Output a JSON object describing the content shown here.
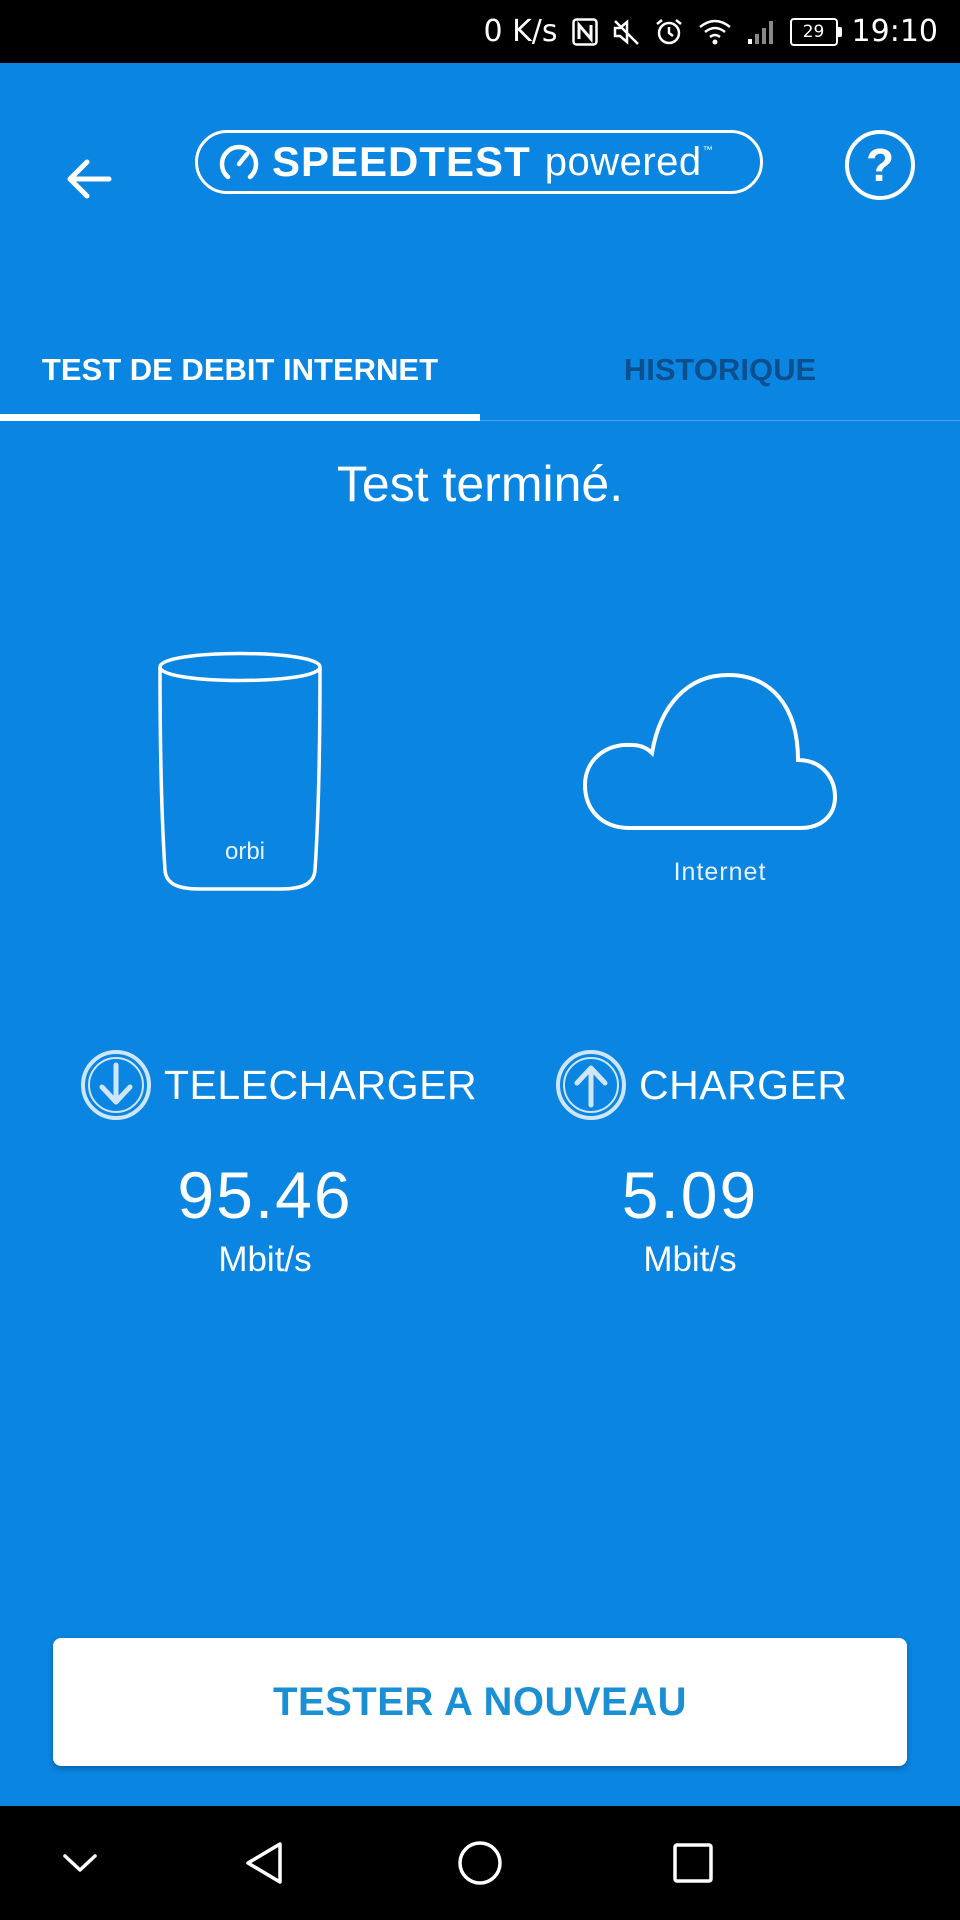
{
  "status_bar": {
    "net_speed": "0 K/s",
    "battery_level": "29",
    "time": "19:10",
    "icons": [
      "nfc-icon",
      "mute-icon",
      "alarm-icon",
      "wifi-icon",
      "signal-icon",
      "battery-icon"
    ]
  },
  "header": {
    "logo_brand": "SPEEDTEST",
    "logo_suffix": "powered",
    "logo_tm": "™",
    "help_label": "?",
    "icons": [
      "back-arrow-icon",
      "speedtest-gauge-icon",
      "help-icon"
    ]
  },
  "tabs": [
    {
      "label": "TEST DE DEBIT INTERNET",
      "selected": true
    },
    {
      "label": "HISTORIQUE",
      "selected": false
    }
  ],
  "status_text": "Test terminé.",
  "illustration": {
    "router_brand": "orbi",
    "internet_label": "Internet",
    "icons": [
      "orbi-router-icon",
      "cloud-icon"
    ]
  },
  "results": {
    "download": {
      "label": "TELECHARGER",
      "value": "95.46",
      "unit": "Mbit/s",
      "icon": "download-arrow-icon"
    },
    "upload": {
      "label": "CHARGER",
      "value": "5.09",
      "unit": "Mbit/s",
      "icon": "upload-arrow-icon"
    }
  },
  "retest_button_label": "TESTER A NOUVEAU",
  "nav_bar": {
    "icons": [
      "nav-hide-icon",
      "nav-back-icon",
      "nav-home-icon",
      "nav-recents-icon"
    ]
  },
  "colors": {
    "background": "#0a85e2",
    "inactive_tab": "#0b4f8f",
    "button_text": "#1a8fd3",
    "button_background": "#ffffff"
  }
}
